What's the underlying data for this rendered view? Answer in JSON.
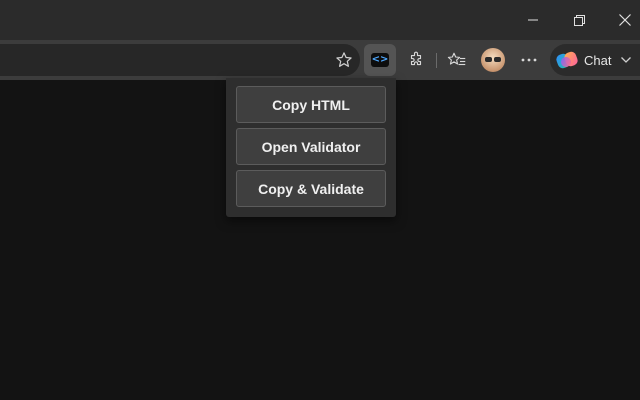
{
  "window_controls": {
    "minimize_icon": "minimize-icon",
    "restore_icon": "restore-icon",
    "close_icon": "close-icon"
  },
  "toolbar": {
    "favorite_icon": "star-outline-icon",
    "active_extension_icon": "code-brackets-icon",
    "extensions_icon": "puzzle-icon",
    "favorites_icon": "favorites-list-icon",
    "profile_icon": "avatar",
    "more_icon": "ellipsis-icon",
    "chat": {
      "label": "Chat",
      "icon": "copilot-icon"
    }
  },
  "popup": {
    "buttons": [
      {
        "label": "Copy HTML"
      },
      {
        "label": "Open Validator"
      },
      {
        "label": "Copy & Validate"
      }
    ]
  },
  "colors": {
    "titlebar": "#2b2b2b",
    "toolbar": "#3c3c3c",
    "page_background": "#131313",
    "popup_background": "#2e2e2e",
    "button_background": "#3f3f3f",
    "extension_accent": "#4fa9ff"
  }
}
